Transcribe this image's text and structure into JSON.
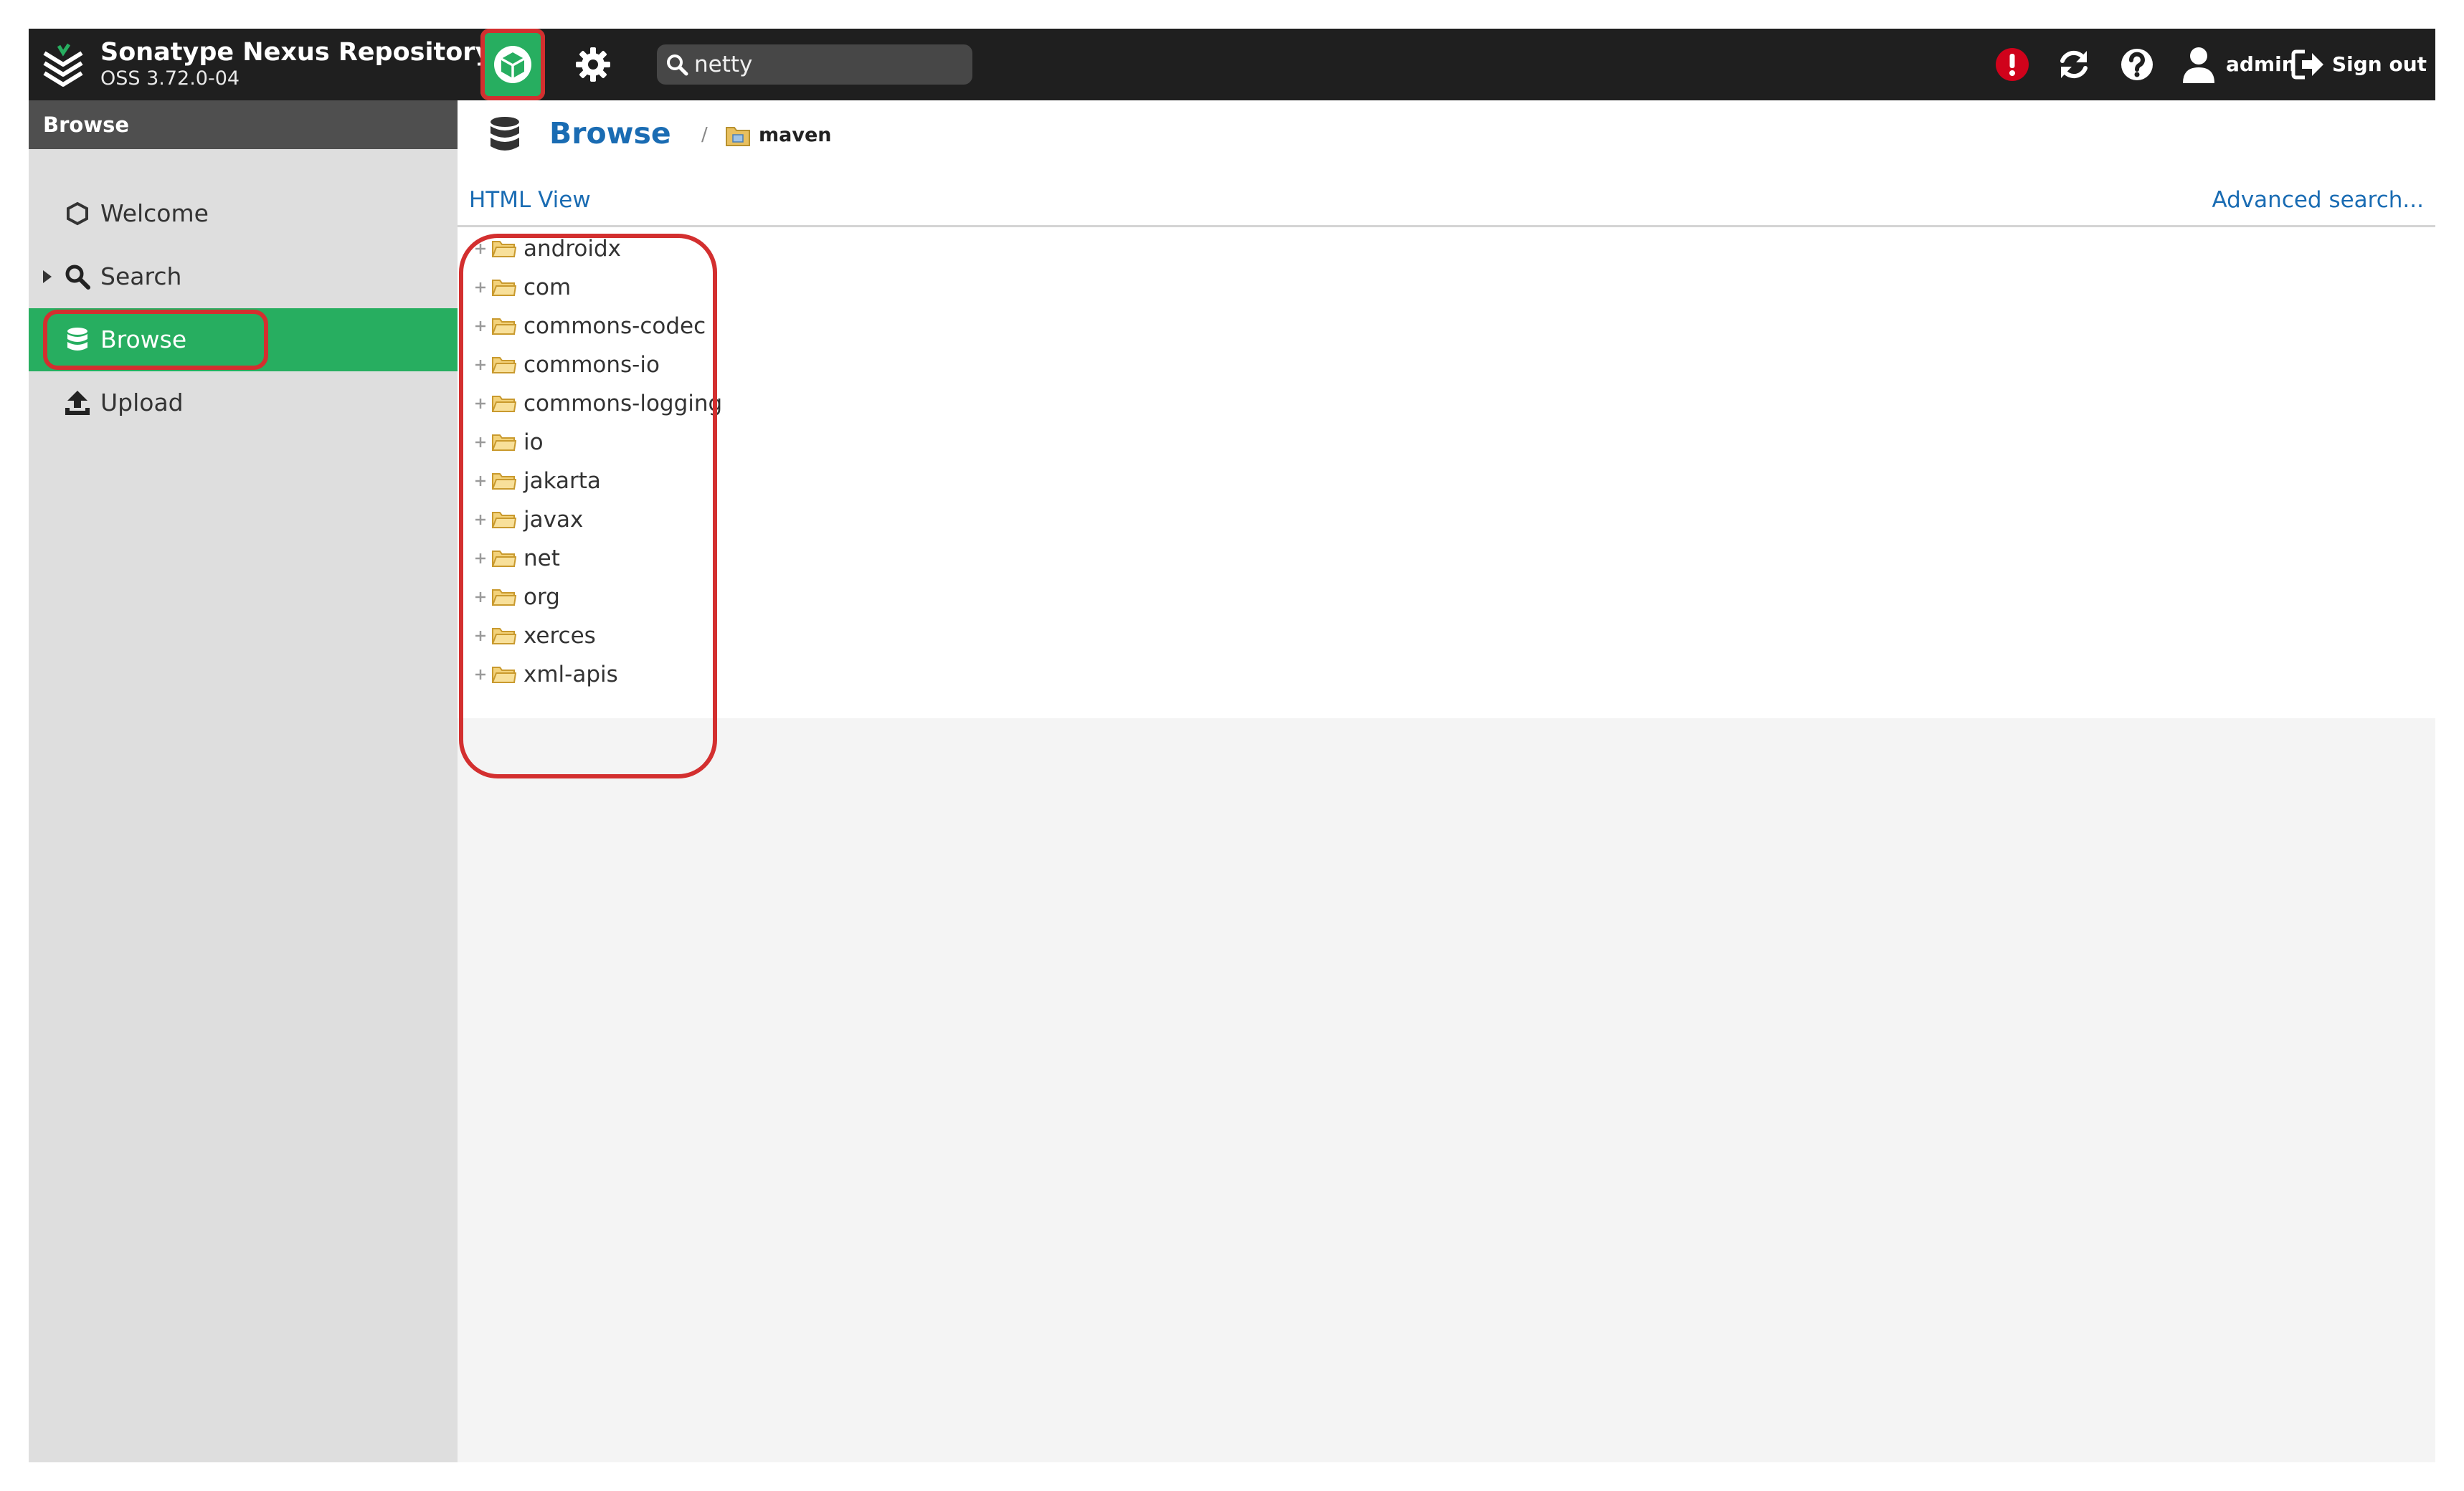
{
  "header": {
    "app_name": "Sonatype Nexus Repository",
    "version": "OSS 3.72.0-04",
    "search": {
      "value": "netty",
      "placeholder": ""
    },
    "user": "admin",
    "sign_out": "Sign out"
  },
  "sidebar": {
    "section_title": "Browse",
    "items": [
      {
        "label": "Welcome",
        "icon": "hexagon-icon"
      },
      {
        "label": "Search",
        "icon": "search-icon"
      },
      {
        "label": "Browse",
        "icon": "database-icon",
        "active": true
      },
      {
        "label": "Upload",
        "icon": "upload-icon"
      }
    ]
  },
  "main": {
    "title": "Browse",
    "breadcrumb_separator": "/",
    "repository": "maven",
    "html_view": "HTML View",
    "advanced_search": "Advanced search...",
    "tree": [
      "androidx",
      "com",
      "commons-codec",
      "commons-io",
      "commons-logging",
      "io",
      "jakarta",
      "javax",
      "net",
      "org",
      "xerces",
      "xml-apis"
    ]
  },
  "colors": {
    "header_bg": "#1f1f1f",
    "accent_green": "#27ae60",
    "link_blue": "#1a6cb3",
    "alert_red": "#d0021b",
    "annotation_red": "#d32f2f",
    "folder_yellow": "#e8c060"
  }
}
